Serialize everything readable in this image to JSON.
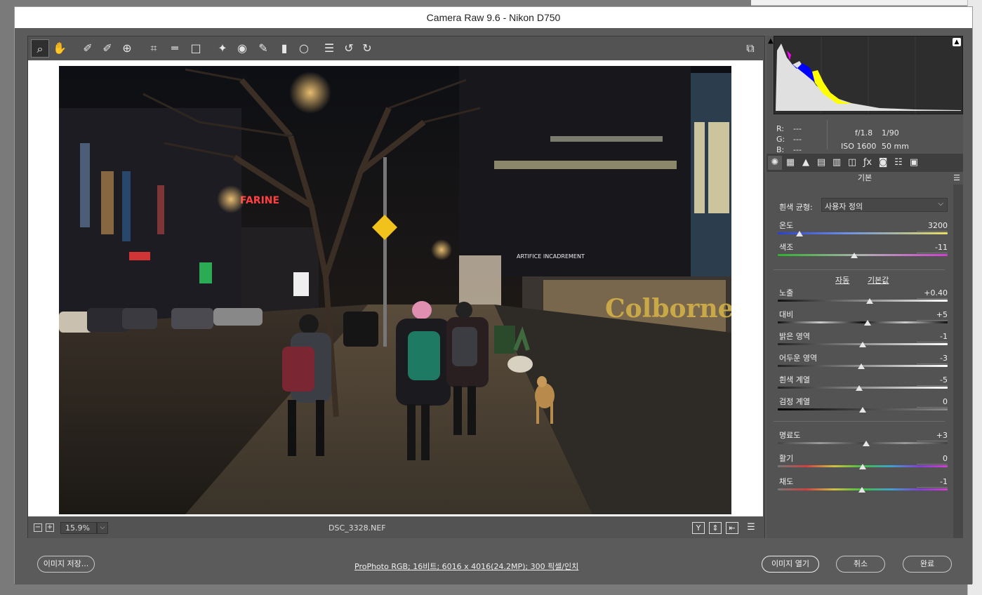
{
  "window": {
    "title": "Camera Raw 9.6  -  Nikon D750"
  },
  "toolbar": {
    "tools": [
      {
        "name": "zoom-tool",
        "glyph": "⌕",
        "active": true
      },
      {
        "name": "hand-tool",
        "glyph": "✋"
      },
      {
        "name": "white-balance-tool",
        "glyph": "✐"
      },
      {
        "name": "color-sampler-tool",
        "glyph": "✐"
      },
      {
        "name": "targeted-adjustment-tool",
        "glyph": "⊕"
      },
      {
        "name": "crop-tool",
        "glyph": "⌗"
      },
      {
        "name": "straighten-tool",
        "glyph": "═"
      },
      {
        "name": "transform-tool",
        "glyph": "□"
      },
      {
        "name": "spot-removal-tool",
        "glyph": "✦"
      },
      {
        "name": "red-eye-tool",
        "glyph": "◉"
      },
      {
        "name": "adjustment-brush-tool",
        "glyph": "✎"
      },
      {
        "name": "graduated-filter-tool",
        "glyph": "▮"
      },
      {
        "name": "radial-filter-tool",
        "glyph": "○"
      },
      {
        "name": "preferences-tool",
        "glyph": "☰"
      },
      {
        "name": "rotate-ccw-tool",
        "glyph": "↺"
      },
      {
        "name": "rotate-cw-tool",
        "glyph": "↻"
      }
    ],
    "fullscreen_glyph": "⧉"
  },
  "photo": {
    "sign_text": "FARINE",
    "shop_text": "Colborne",
    "arret_text": "ARTIFICE INCADREMENT"
  },
  "status": {
    "zoom": "15.9%",
    "filename": "DSC_3328.NEF"
  },
  "info": {
    "r": "R:",
    "g": "G:",
    "b": "B:",
    "r_val": "---",
    "g_val": "---",
    "b_val": "---",
    "aperture": "f/1.8",
    "shutter": "1/90",
    "iso": "ISO 1600",
    "focal": "50 mm"
  },
  "panel": {
    "title": "기본",
    "wb_label": "흰색 균형:",
    "wb_value": "사용자 정의",
    "auto": "자동",
    "default": "기본값",
    "sliders": {
      "temp": {
        "label": "온도",
        "value": "3200",
        "pos": 0.13
      },
      "tint": {
        "label": "색조",
        "value": "-11",
        "pos": 0.45
      },
      "exposure": {
        "label": "노출",
        "value": "+0.40",
        "pos": 0.54
      },
      "contrast": {
        "label": "대비",
        "value": "+5",
        "pos": 0.53
      },
      "highlights": {
        "label": "밝은 영역",
        "value": "-1",
        "pos": 0.5
      },
      "shadows": {
        "label": "어두운 영역",
        "value": "-3",
        "pos": 0.49
      },
      "whites": {
        "label": "흰색 계열",
        "value": "-5",
        "pos": 0.48
      },
      "blacks": {
        "label": "검정 계열",
        "value": "0",
        "pos": 0.5
      },
      "clarity": {
        "label": "명료도",
        "value": "+3",
        "pos": 0.52
      },
      "vibrance": {
        "label": "활기",
        "value": "0",
        "pos": 0.5
      },
      "saturation": {
        "label": "채도",
        "value": "-1",
        "pos": 0.495
      }
    }
  },
  "footer": {
    "save": "이미지 저장...",
    "workflow": "ProPhoto RGB; 16비트; 6016 x 4016(24.2MP); 300 픽셀/인치",
    "open": "이미지 열기",
    "cancel": "취소",
    "done": "완료"
  }
}
